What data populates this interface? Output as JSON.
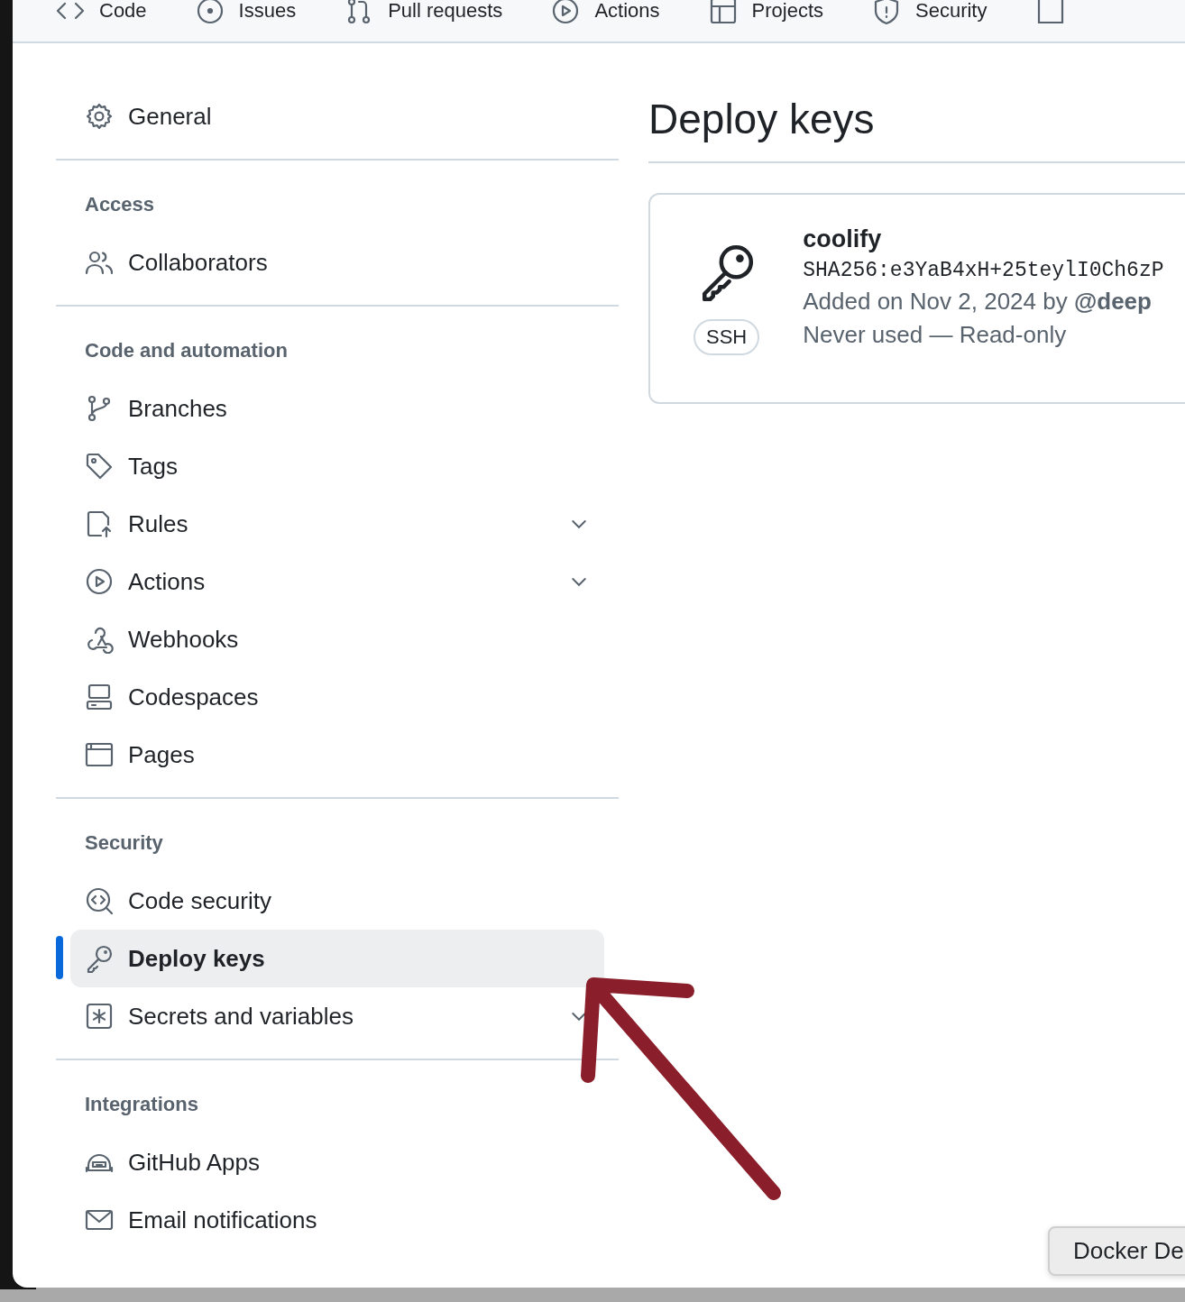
{
  "repo_tabs": [
    {
      "label": "Code"
    },
    {
      "label": "Issues"
    },
    {
      "label": "Pull requests"
    },
    {
      "label": "Actions"
    },
    {
      "label": "Projects"
    },
    {
      "label": "Security"
    }
  ],
  "sidebar": {
    "top_item": {
      "label": "General",
      "selected": false
    },
    "sections": [
      {
        "heading": "Access",
        "items": [
          {
            "label": "Collaborators",
            "selected": false
          }
        ]
      },
      {
        "heading": "Code and automation",
        "items": [
          {
            "label": "Branches",
            "selected": false
          },
          {
            "label": "Tags",
            "selected": false
          },
          {
            "label": "Rules",
            "selected": false,
            "expanded": false
          },
          {
            "label": "Actions",
            "selected": false,
            "expanded": false
          },
          {
            "label": "Webhooks",
            "selected": false
          },
          {
            "label": "Codespaces",
            "selected": false
          },
          {
            "label": "Pages",
            "selected": false
          }
        ]
      },
      {
        "heading": "Security",
        "items": [
          {
            "label": "Code security",
            "selected": false
          },
          {
            "label": "Deploy keys",
            "selected": true
          },
          {
            "label": "Secrets and variables",
            "selected": false,
            "expanded": false
          }
        ]
      },
      {
        "heading": "Integrations",
        "items": [
          {
            "label": "GitHub Apps",
            "selected": false
          },
          {
            "label": "Email notifications",
            "selected": false
          }
        ]
      }
    ]
  },
  "main": {
    "title": "Deploy keys",
    "keys": [
      {
        "badge": "SSH",
        "name": "coolify",
        "fingerprint": "SHA256:e3YaB4xH+25teylI0Ch6zP",
        "added_prefix": "Added on Nov 2, 2024 by ",
        "added_by": "@deep",
        "usage": "Never used — Read-only"
      }
    ]
  },
  "tooltip": "Docker De"
}
